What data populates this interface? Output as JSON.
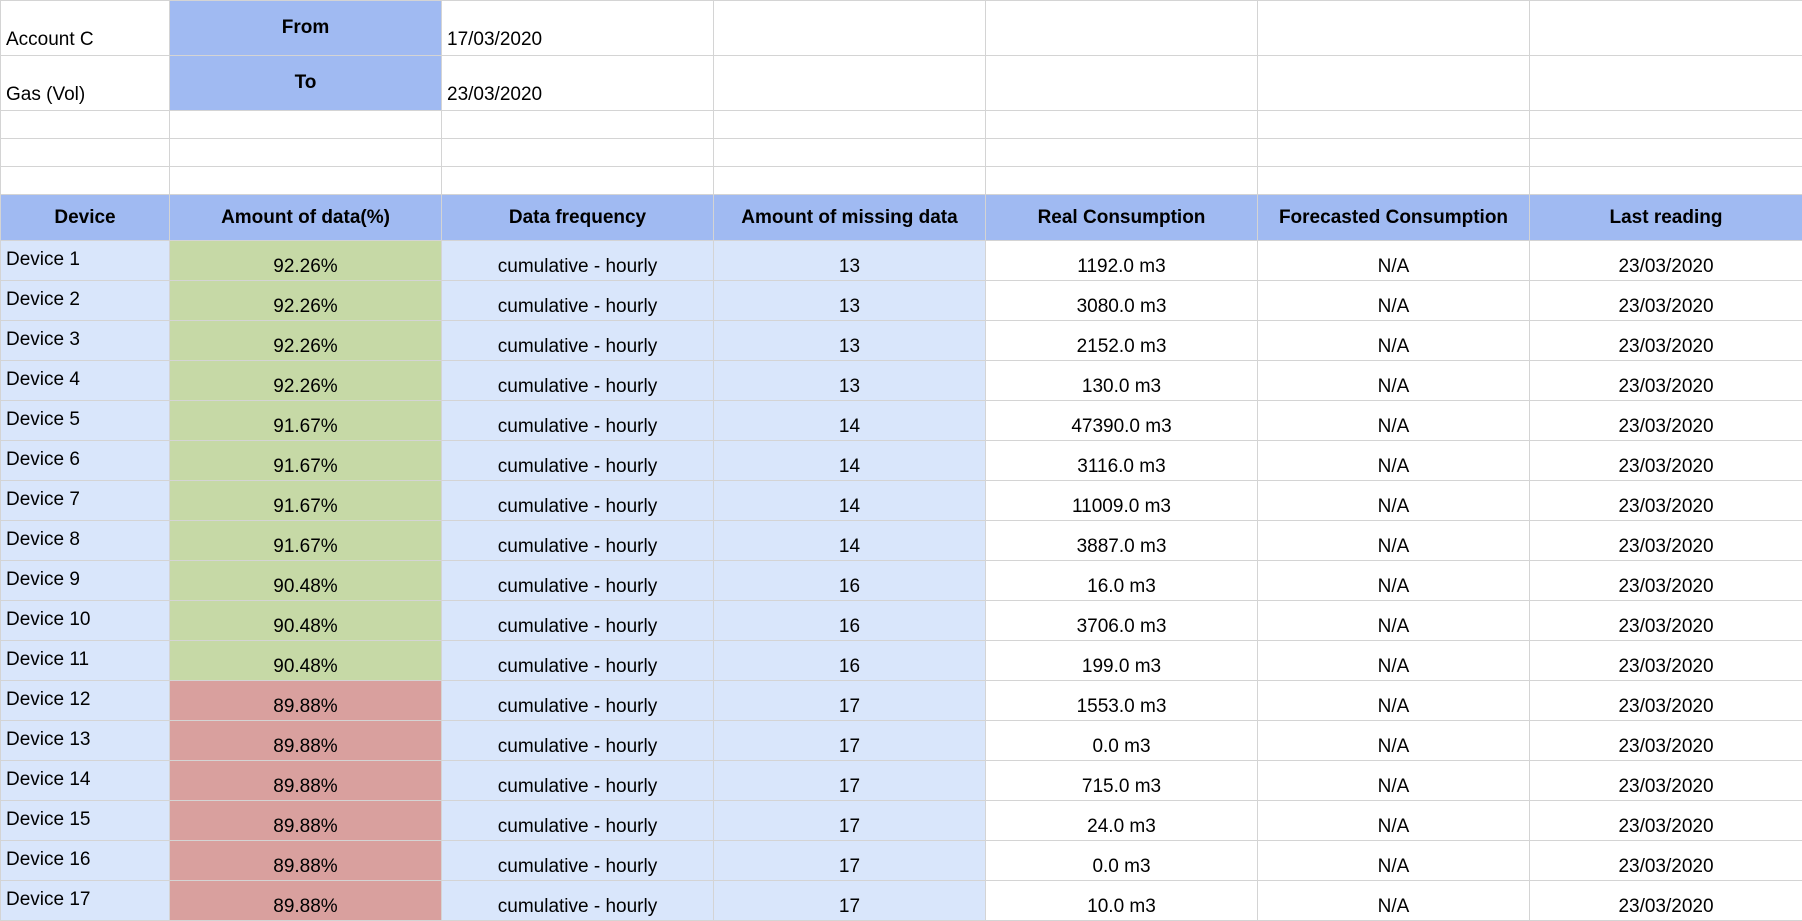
{
  "meta": {
    "account": "Account C",
    "type": "Gas (Vol)",
    "from_label": "From",
    "to_label": "To",
    "from_date": "17/03/2020",
    "to_date": "23/03/2020"
  },
  "columns": [
    "Device",
    "Amount of data(%)",
    "Data frequency",
    "Amount of missing data",
    "Real Consumption",
    "Forecasted Consumption",
    "Last reading"
  ],
  "colors": {
    "header_blue": "#a0baf2",
    "light_blue": "#d9e6fb",
    "good_green": "#c6d9a6",
    "bad_red": "#d9a09e"
  },
  "rows": [
    {
      "device": "Device 1",
      "amount": "92.26%",
      "frequency": "cumulative - hourly",
      "missing": "13",
      "real": "1192.0 m3",
      "forecast": "N/A",
      "last": "23/03/2020",
      "status": "good"
    },
    {
      "device": "Device 2",
      "amount": "92.26%",
      "frequency": "cumulative - hourly",
      "missing": "13",
      "real": "3080.0 m3",
      "forecast": "N/A",
      "last": "23/03/2020",
      "status": "good"
    },
    {
      "device": "Device 3",
      "amount": "92.26%",
      "frequency": "cumulative - hourly",
      "missing": "13",
      "real": "2152.0 m3",
      "forecast": "N/A",
      "last": "23/03/2020",
      "status": "good"
    },
    {
      "device": "Device 4",
      "amount": "92.26%",
      "frequency": "cumulative - hourly",
      "missing": "13",
      "real": "130.0 m3",
      "forecast": "N/A",
      "last": "23/03/2020",
      "status": "good"
    },
    {
      "device": "Device 5",
      "amount": "91.67%",
      "frequency": "cumulative - hourly",
      "missing": "14",
      "real": "47390.0 m3",
      "forecast": "N/A",
      "last": "23/03/2020",
      "status": "good"
    },
    {
      "device": "Device 6",
      "amount": "91.67%",
      "frequency": "cumulative - hourly",
      "missing": "14",
      "real": "3116.0 m3",
      "forecast": "N/A",
      "last": "23/03/2020",
      "status": "good"
    },
    {
      "device": "Device 7",
      "amount": "91.67%",
      "frequency": "cumulative - hourly",
      "missing": "14",
      "real": "11009.0 m3",
      "forecast": "N/A",
      "last": "23/03/2020",
      "status": "good"
    },
    {
      "device": "Device 8",
      "amount": "91.67%",
      "frequency": "cumulative - hourly",
      "missing": "14",
      "real": "3887.0 m3",
      "forecast": "N/A",
      "last": "23/03/2020",
      "status": "good"
    },
    {
      "device": "Device 9",
      "amount": "90.48%",
      "frequency": "cumulative - hourly",
      "missing": "16",
      "real": "16.0 m3",
      "forecast": "N/A",
      "last": "23/03/2020",
      "status": "good"
    },
    {
      "device": "Device 10",
      "amount": "90.48%",
      "frequency": "cumulative - hourly",
      "missing": "16",
      "real": "3706.0 m3",
      "forecast": "N/A",
      "last": "23/03/2020",
      "status": "good"
    },
    {
      "device": "Device 11",
      "amount": "90.48%",
      "frequency": "cumulative - hourly",
      "missing": "16",
      "real": "199.0 m3",
      "forecast": "N/A",
      "last": "23/03/2020",
      "status": "good"
    },
    {
      "device": "Device 12",
      "amount": "89.88%",
      "frequency": "cumulative - hourly",
      "missing": "17",
      "real": "1553.0 m3",
      "forecast": "N/A",
      "last": "23/03/2020",
      "status": "bad"
    },
    {
      "device": "Device 13",
      "amount": "89.88%",
      "frequency": "cumulative - hourly",
      "missing": "17",
      "real": "0.0 m3",
      "forecast": "N/A",
      "last": "23/03/2020",
      "status": "bad"
    },
    {
      "device": "Device 14",
      "amount": "89.88%",
      "frequency": "cumulative - hourly",
      "missing": "17",
      "real": "715.0 m3",
      "forecast": "N/A",
      "last": "23/03/2020",
      "status": "bad"
    },
    {
      "device": "Device 15",
      "amount": "89.88%",
      "frequency": "cumulative - hourly",
      "missing": "17",
      "real": "24.0 m3",
      "forecast": "N/A",
      "last": "23/03/2020",
      "status": "bad"
    },
    {
      "device": "Device 16",
      "amount": "89.88%",
      "frequency": "cumulative - hourly",
      "missing": "17",
      "real": "0.0 m3",
      "forecast": "N/A",
      "last": "23/03/2020",
      "status": "bad"
    },
    {
      "device": "Device 17",
      "amount": "89.88%",
      "frequency": "cumulative - hourly",
      "missing": "17",
      "real": "10.0 m3",
      "forecast": "N/A",
      "last": "23/03/2020",
      "status": "bad"
    }
  ]
}
